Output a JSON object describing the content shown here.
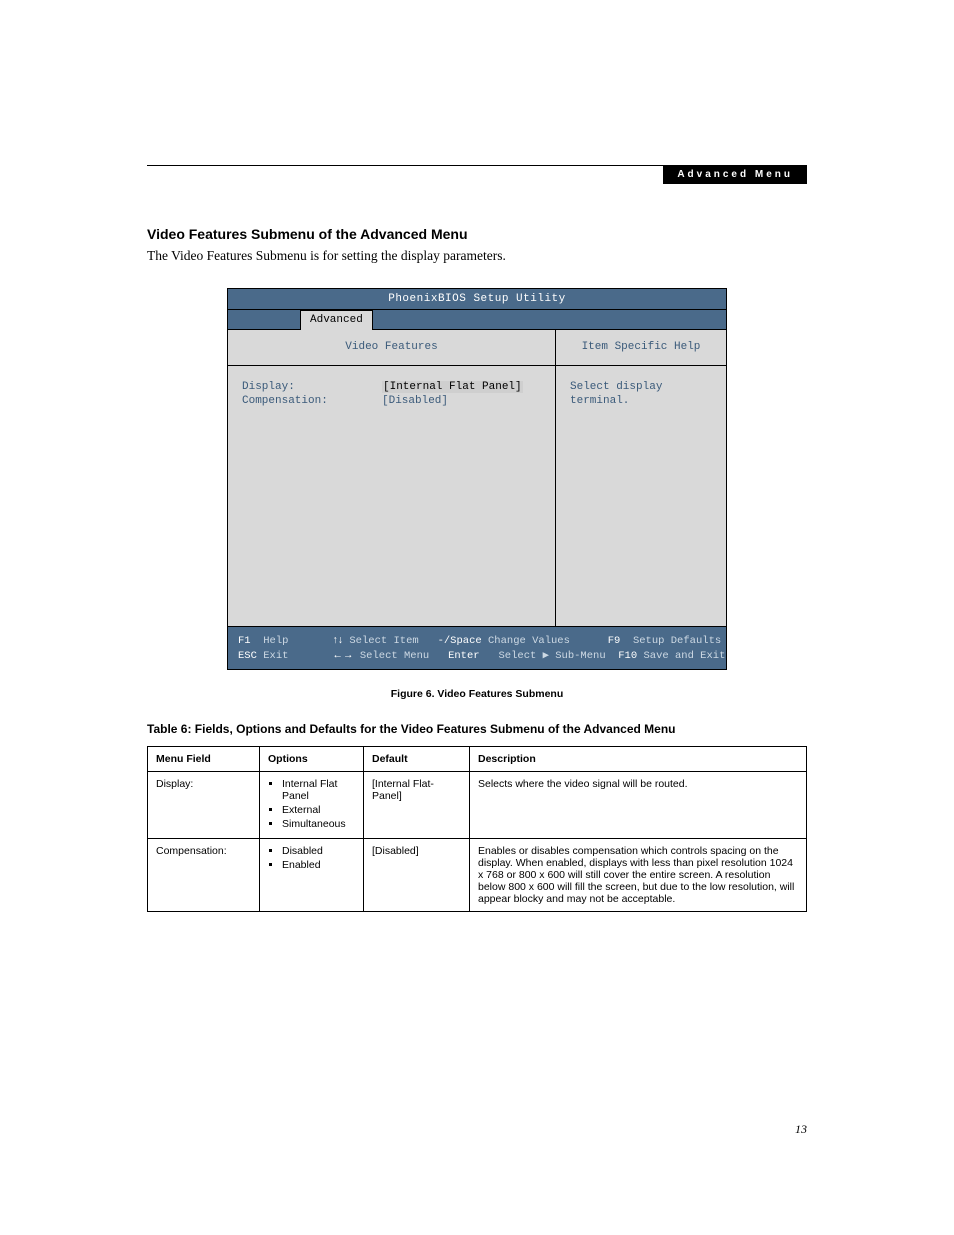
{
  "header": {
    "chip": "Advanced Menu"
  },
  "section": {
    "title": "Video Features Submenu of the Advanced Menu",
    "intro": "The Video Features Submenu is for setting the display parameters."
  },
  "bios": {
    "title": "PhoenixBIOS Setup Utility",
    "active_tab": "Advanced",
    "left_header": "Video Features",
    "right_header": "Item Specific Help",
    "fields": {
      "display": {
        "label": "Display:",
        "value": "[Internal Flat Panel]"
      },
      "compensation": {
        "label": "Compensation:",
        "value": "[Disabled]"
      }
    },
    "help_text": "Select display terminal.",
    "footer": {
      "l1_k1": "F1",
      "l1_v1": "Help",
      "l1_k2": "↑↓",
      "l1_v2": "Select Item",
      "l1_k3": "-/Space",
      "l1_v3": "Change Values",
      "l1_k4": "F9",
      "l1_v4": "Setup Defaults",
      "l2_k1": "ESC",
      "l2_v1": "Exit",
      "l2_k2": "←→",
      "l2_v2": "Select Menu",
      "l2_k3": "Enter",
      "l2_v3": "Select ▶ Sub-Menu",
      "l2_k4": "F10",
      "l2_v4": "Save and Exit"
    }
  },
  "figure_caption": "Figure 6.  Video Features Submenu",
  "table": {
    "title": "Table 6: Fields, Options and Defaults for the Video Features Submenu of the Advanced Menu",
    "headers": {
      "c1": "Menu Field",
      "c2": "Options",
      "c3": "Default",
      "c4": "Description"
    },
    "rows": [
      {
        "field": "Display:",
        "options": [
          "Internal Flat Panel",
          "External",
          "Simultaneous"
        ],
        "default": "[Internal Flat-Panel]",
        "description": "Selects where the video signal will be routed."
      },
      {
        "field": "Compensation:",
        "options": [
          "Disabled",
          "Enabled"
        ],
        "default": "[Disabled]",
        "description": "Enables or disables compensation which controls spacing on the display. When enabled, displays with less than pixel resolution 1024 x 768 or 800 x 600 will still cover the entire screen. A resolution below 800 x 600 will fill the screen, but due to the low resolution, will appear blocky and may not be acceptable."
      }
    ]
  },
  "page_number": "13"
}
